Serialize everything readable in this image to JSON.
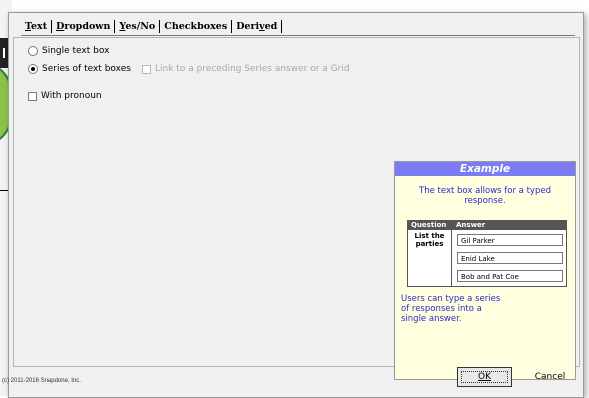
{
  "tabs": [
    {
      "label": "Text",
      "selected": true
    },
    {
      "label": "Dropdown",
      "selected": false
    },
    {
      "label": "Yes/No",
      "selected": false
    },
    {
      "label": "Checkboxes",
      "selected": false
    },
    {
      "label": "Derived",
      "selected": false
    }
  ],
  "options": {
    "single": {
      "label": "Single text box",
      "checked": false
    },
    "series": {
      "label": "Series of text boxes",
      "checked": true
    },
    "link": {
      "label": "Link to a preceding Series answer or a Grid",
      "checked": false,
      "enabled": false
    },
    "pronoun": {
      "label": "With pronoun",
      "checked": false
    }
  },
  "example": {
    "title": "Example",
    "description": "The text box allows for a typed response.",
    "table": {
      "headers": [
        "Question",
        "Answer"
      ],
      "question": "List the parties",
      "answers": [
        "Gil Parker",
        "Enid Lake",
        "Bob and Pat Coe"
      ]
    },
    "note": "Users can type a series of responses into a single answer."
  },
  "footer": {
    "copyright": "(c) 2011-2016 Snapdone, Inc.",
    "ok_label": "OK",
    "cancel_label": "Cancel"
  }
}
